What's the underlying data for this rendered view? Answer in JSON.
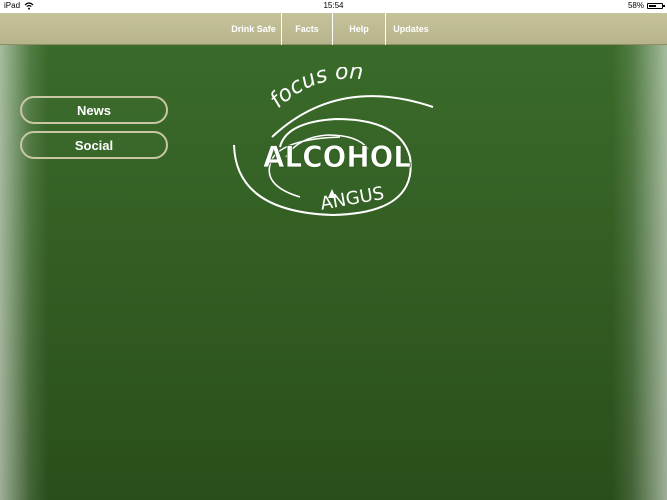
{
  "status_bar": {
    "device": "iPad",
    "time": "15:54",
    "battery_text": "58%",
    "battery_level": 0.58,
    "wifi_icon": "wifi-icon"
  },
  "nav": {
    "items": [
      {
        "label": "Drink Safe"
      },
      {
        "label": "Facts"
      },
      {
        "label": "Help"
      },
      {
        "label": "Updates"
      }
    ]
  },
  "sidebar": {
    "buttons": [
      {
        "label": "News"
      },
      {
        "label": "Social"
      }
    ]
  },
  "logo": {
    "line1": "focus on",
    "line2": "ALCOHOL",
    "line3": "ANGUS"
  },
  "colors": {
    "nav_bg": "#c0bd94",
    "green_main": "#2e5a1e",
    "button_border": "#c9c7a3"
  }
}
